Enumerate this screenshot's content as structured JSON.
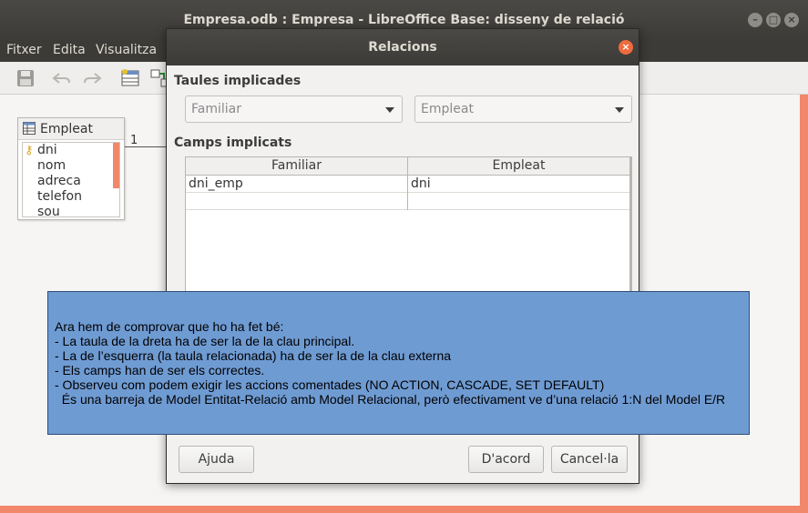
{
  "window": {
    "title": "Empresa.odb : Empresa - LibreOffice Base: disseny de relació"
  },
  "menu": {
    "items": [
      "Fitxer",
      "Edita",
      "Visualitza"
    ]
  },
  "designer": {
    "table": {
      "name": "Empleat",
      "fields": [
        "dni",
        "nom",
        "adreca",
        "telefon",
        "sou"
      ]
    },
    "relation_cardinality_label": "1"
  },
  "dialog": {
    "title": "Relacions",
    "tables_section": "Taules implicades",
    "left_table": "Familiar",
    "right_table": "Empleat",
    "fields_section": "Camps implicats",
    "grid": {
      "headers": [
        "Familiar",
        "Empleat"
      ],
      "rows": [
        [
          "dni_emp",
          "dni"
        ],
        [
          "",
          ""
        ]
      ]
    },
    "buttons": {
      "help": "Ajuda",
      "ok": "D'acord",
      "cancel": "Cancel·la"
    }
  },
  "note": {
    "lines": [
      "Ara hem de comprovar que ho ha fet bé:",
      "- La taula de la dreta ha de ser la de la clau principal.",
      "- La de l’esquerra (la taula relacionada) ha de ser la de la clau externa",
      "- Els camps han de ser els correctes.",
      "- Observeu com podem exigir les accions comentades (NO ACTION, CASCADE, SET DEFAULT)",
      "  És una barreja de Model Entitat-Relació amb Model Relacional, però efectivament ve d’una relació 1:N del Model E/R"
    ]
  },
  "colors": {
    "accent": "#f1876b",
    "note_bg": "#6f9bd3",
    "titlebar": "#3c3b37"
  },
  "icons": [
    "save-icon",
    "undo-icon",
    "redo-icon",
    "new-table-icon",
    "new-relation-icon",
    "key-icon",
    "table-icon",
    "close-icon"
  ]
}
